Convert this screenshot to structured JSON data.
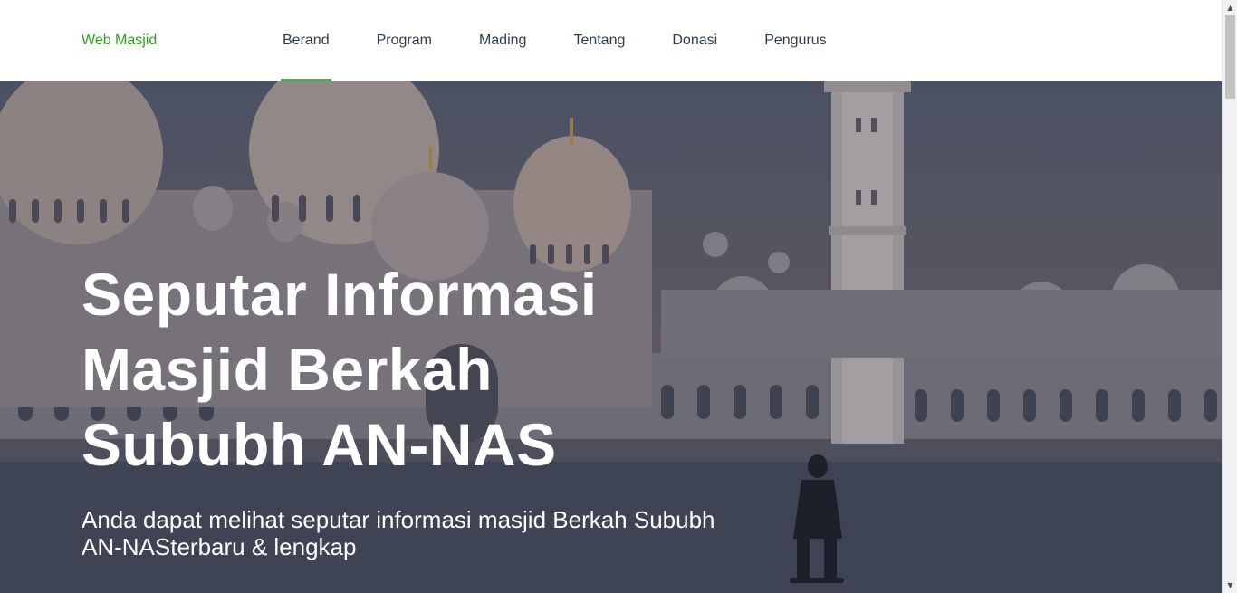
{
  "nav": {
    "brand": "Web Masjid",
    "links": [
      "Berand",
      "Program",
      "Mading",
      "Tentang",
      "Donasi",
      "Pengurus"
    ],
    "active_index": 0
  },
  "hero": {
    "title": "Seputar Informasi Masjid Berkah Sububh AN-NAS",
    "subtitle": "Anda dapat melihat seputar informasi masjid Berkah Sububh AN-NASterbaru & lengkap",
    "background_image": "mosque-domes-and-minaret-photo"
  },
  "colors": {
    "brand": "#2e9e1f",
    "active_underline": "#3bb84a",
    "nav_text": "#2f3d4a",
    "hero_text": "#ffffff"
  },
  "scrollbar": {
    "up_icon": "arrow-up-icon",
    "down_icon": "arrow-down-icon"
  }
}
